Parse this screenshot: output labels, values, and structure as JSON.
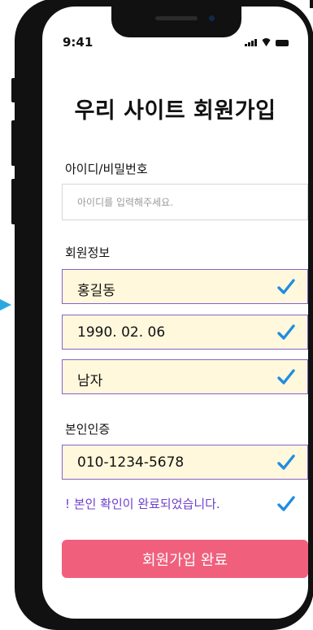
{
  "status_bar": {
    "time": "9:41"
  },
  "title": "우리 사이트 회원가입",
  "account": {
    "label": "아이디/비밀번호",
    "placeholder": "아이디를 입력해주세요."
  },
  "member_info": {
    "label": "회원정보",
    "fields": [
      {
        "value": "홍길동",
        "verified": true
      },
      {
        "value": "1990. 02. 06",
        "verified": true
      },
      {
        "value": "남자",
        "verified": true
      }
    ]
  },
  "identity": {
    "label": "본인인증",
    "phone": "010-1234-5678",
    "message": "! 본인 확인이 완료되었습니다."
  },
  "submit_label": "회원가입 완료",
  "colors": {
    "accent_purple": "#6e3fcf",
    "field_border": "#8663c9",
    "field_bg": "#fff8dc",
    "check_blue": "#1f8de0",
    "submit_pink": "#f0607d",
    "side_marker": "#2aa9e0"
  }
}
